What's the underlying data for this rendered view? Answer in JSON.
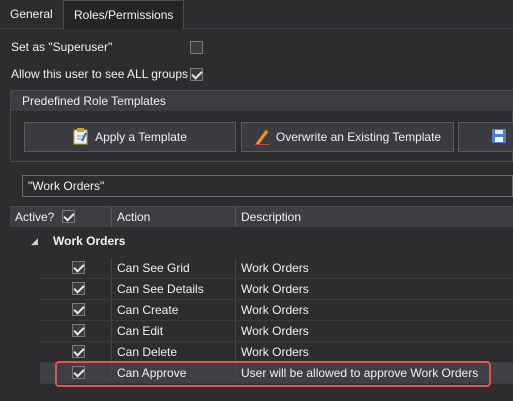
{
  "tabs": [
    {
      "label": "General"
    },
    {
      "label": "Roles/Permissions"
    }
  ],
  "options": {
    "superuser_label": "Set as \"Superuser\"",
    "superuser_checked": false,
    "all_groups_label": "Allow this user to see ALL groups",
    "all_groups_checked": true
  },
  "templates": {
    "title": "Predefined Role Templates",
    "apply_label": "Apply a Template",
    "overwrite_label": "Overwrite an Existing Template"
  },
  "filter": {
    "value": "\"Work Orders\""
  },
  "grid": {
    "columns": {
      "active": "Active?",
      "action": "Action",
      "description": "Description"
    },
    "group": "Work Orders",
    "rows": [
      {
        "checked": true,
        "action": "Can See Grid",
        "description": "Work Orders"
      },
      {
        "checked": true,
        "action": "Can See Details",
        "description": "Work Orders"
      },
      {
        "checked": true,
        "action": "Can Create",
        "description": "Work Orders"
      },
      {
        "checked": true,
        "action": "Can Edit",
        "description": "Work Orders"
      },
      {
        "checked": true,
        "action": "Can Delete",
        "description": "Work Orders"
      },
      {
        "checked": true,
        "action": "Can Approve",
        "description": "User will be allowed to approve Work Orders"
      }
    ]
  },
  "colors": {
    "highlight": "#e05454",
    "background": "#2d2d30"
  }
}
